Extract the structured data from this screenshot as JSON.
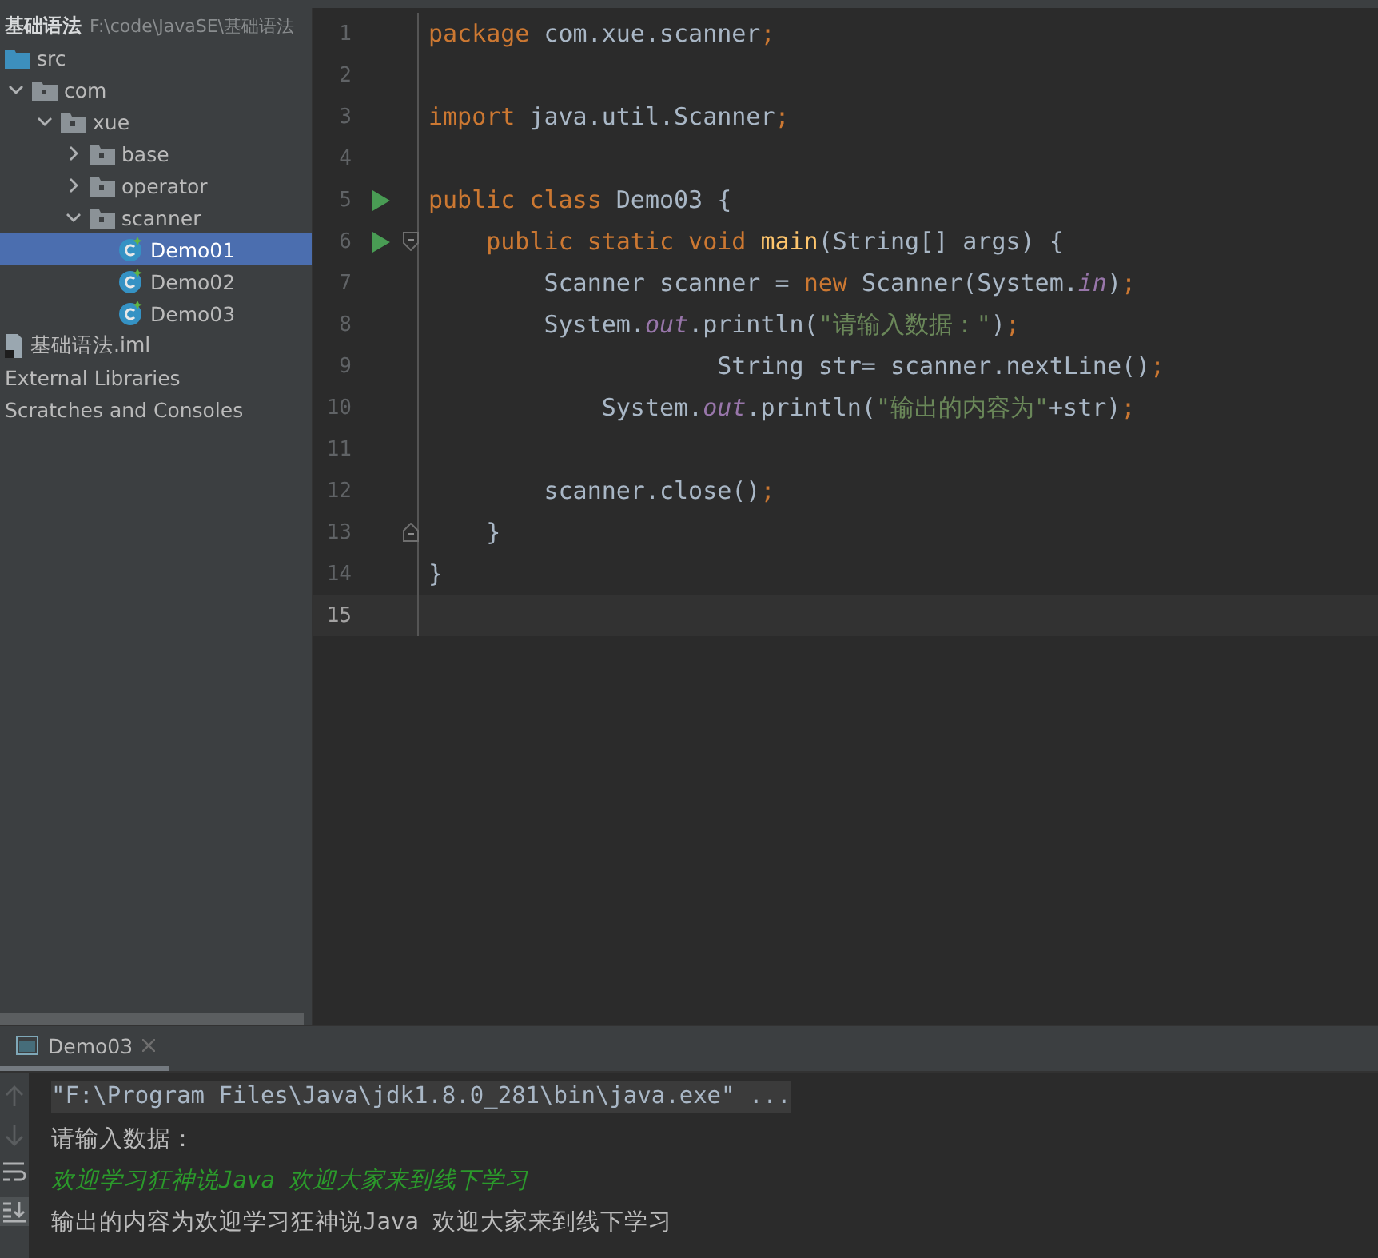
{
  "project": {
    "name": "基础语法",
    "path": "F:\\code\\JavaSE\\基础语法",
    "tree": [
      {
        "label": "src",
        "kind": "source",
        "selected": false
      },
      {
        "label": "com",
        "kind": "package",
        "expanded": true,
        "selected": false,
        "children": [
          {
            "label": "xue",
            "kind": "package",
            "expanded": true,
            "selected": false,
            "children": [
              {
                "label": "base",
                "kind": "package",
                "expanded": false,
                "selected": false
              },
              {
                "label": "operator",
                "kind": "package",
                "expanded": false,
                "selected": false
              },
              {
                "label": "scanner",
                "kind": "package",
                "expanded": true,
                "selected": false,
                "children": [
                  {
                    "label": "Demo01",
                    "kind": "class",
                    "selected": true
                  },
                  {
                    "label": "Demo02",
                    "kind": "class",
                    "selected": false
                  },
                  {
                    "label": "Demo03",
                    "kind": "class",
                    "selected": false
                  }
                ]
              }
            ]
          }
        ]
      },
      {
        "label": "基础语法.iml",
        "kind": "module_file",
        "selected": false
      },
      {
        "label": "External Libraries",
        "kind": "plain",
        "selected": false
      },
      {
        "label": "Scratches and Consoles",
        "kind": "plain",
        "selected": false
      }
    ]
  },
  "editor": {
    "lines": [
      {
        "number": "1",
        "tokens": [
          {
            "kind": "keyword",
            "text": "package "
          },
          {
            "kind": "plain",
            "text": "com.xue.scanner"
          },
          {
            "kind": "keyword",
            "text": ";"
          }
        ]
      },
      {
        "number": "2"
      },
      {
        "number": "3",
        "tokens": [
          {
            "kind": "keyword",
            "text": "import "
          },
          {
            "kind": "plain",
            "text": "java.util.Scanner"
          },
          {
            "kind": "keyword",
            "text": ";"
          }
        ]
      },
      {
        "number": "4"
      },
      {
        "number": "5",
        "run": true,
        "tokens": [
          {
            "kind": "keyword",
            "text": "public class "
          },
          {
            "kind": "plain",
            "text": "Demo03 {"
          }
        ]
      },
      {
        "number": "6",
        "run": true,
        "fold_open": true,
        "tokens": [
          {
            "kind": "keyword",
            "text": "    public static void "
          },
          {
            "kind": "method",
            "text": "main"
          },
          {
            "kind": "plain",
            "text": "(String[] args) {"
          }
        ]
      },
      {
        "number": "7",
        "tokens": [
          {
            "kind": "plain",
            "text": "        Scanner scanner = "
          },
          {
            "kind": "keyword",
            "text": "new "
          },
          {
            "kind": "plain",
            "text": "Scanner(System."
          },
          {
            "kind": "field",
            "text": "in"
          },
          {
            "kind": "plain",
            "text": ")"
          },
          {
            "kind": "keyword",
            "text": ";"
          }
        ]
      },
      {
        "number": "8",
        "tokens": [
          {
            "kind": "plain",
            "text": "        System."
          },
          {
            "kind": "field",
            "text": "out"
          },
          {
            "kind": "plain",
            "text": ".println("
          },
          {
            "kind": "string",
            "text": "\"请输入数据：\""
          },
          {
            "kind": "plain",
            "text": ")"
          },
          {
            "kind": "keyword",
            "text": ";"
          }
        ]
      },
      {
        "number": "9",
        "tokens": [
          {
            "kind": "plain",
            "text": "                    String str= scanner.nextLine()"
          },
          {
            "kind": "keyword",
            "text": ";"
          }
        ]
      },
      {
        "number": "10",
        "tokens": [
          {
            "kind": "plain",
            "text": "            System."
          },
          {
            "kind": "field",
            "text": "out"
          },
          {
            "kind": "plain",
            "text": ".println("
          },
          {
            "kind": "string",
            "text": "\"输出的内容为\""
          },
          {
            "kind": "plain",
            "text": "+str)"
          },
          {
            "kind": "keyword",
            "text": ";"
          }
        ]
      },
      {
        "number": "11"
      },
      {
        "number": "12",
        "tokens": [
          {
            "kind": "plain",
            "text": "        scanner.close()"
          },
          {
            "kind": "keyword",
            "text": ";"
          }
        ]
      },
      {
        "number": "13",
        "fold_close": true,
        "tokens": [
          {
            "kind": "plain",
            "text": "    }"
          }
        ]
      },
      {
        "number": "14",
        "tokens": [
          {
            "kind": "plain",
            "text": "}"
          }
        ]
      },
      {
        "number": "15",
        "current": true
      }
    ]
  },
  "run_panel": {
    "tab": "Demo03",
    "console": [
      {
        "kind": "command",
        "text": "\"F:\\Program Files\\Java\\jdk1.8.0_281\\bin\\java.exe\" ..."
      },
      {
        "kind": "output",
        "text": "请输入数据："
      },
      {
        "kind": "input",
        "text": "欢迎学习狂神说Java 欢迎大家来到线下学习"
      },
      {
        "kind": "output",
        "text": "输出的内容为欢迎学习狂神说Java 欢迎大家来到线下学习"
      }
    ]
  }
}
